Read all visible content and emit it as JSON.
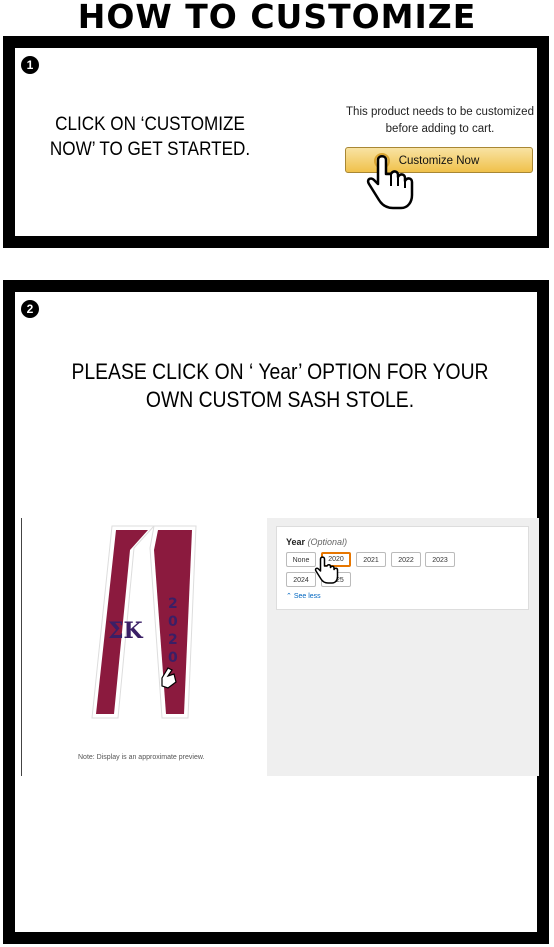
{
  "title": "HOW TO CUSTOMIZE",
  "step1": {
    "number": "1",
    "instruction": "CLICK ON ‘CUSTOMIZE NOW’ TO GET STARTED.",
    "note": "This product needs to be customized before adding to cart.",
    "button_label": "Customize Now"
  },
  "step2": {
    "number": "2",
    "instruction": "PLEASE CLICK ON ‘ Year’ OPTION FOR YOUR OWN CUSTOM SASH STOLE.",
    "preview_note": "Note: Display is an approximate preview.",
    "option_label": "Year",
    "option_hint": "(Optional)",
    "years": [
      "None",
      "2020",
      "2021",
      "2022",
      "2023",
      "2024",
      "2025"
    ],
    "selected_year": "2020",
    "see_less": "See less",
    "stole_letters": "ΣΚ",
    "stole_year_digits": [
      "2",
      "0",
      "2",
      "0"
    ]
  },
  "colors": {
    "stole": "#8b1a3e",
    "stole_text": "#3a1f66",
    "button": "#f0c14b",
    "selected_border": "#e77600"
  }
}
